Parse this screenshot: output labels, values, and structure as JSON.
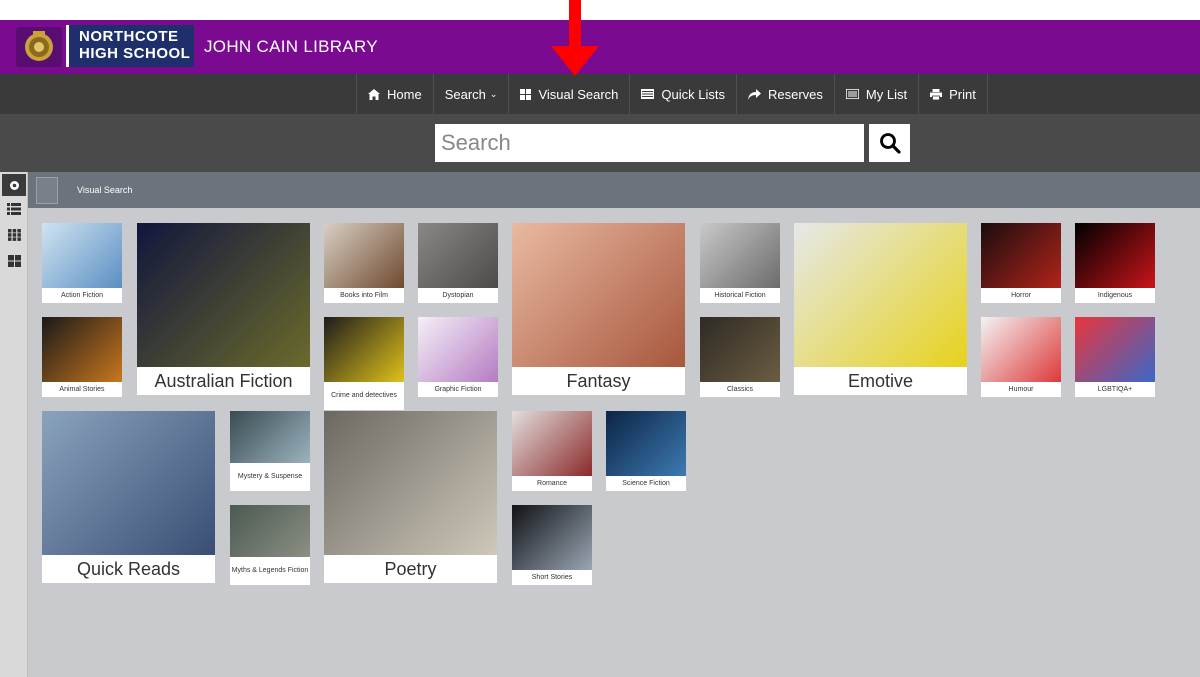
{
  "header": {
    "school_line1": "NORTHCOTE",
    "school_line2": "HIGH SCHOOL",
    "library_name": "JOHN CAIN LIBRARY"
  },
  "nav": {
    "items": [
      {
        "label": "Home",
        "icon": "home-icon"
      },
      {
        "label": "Search",
        "icon": "none",
        "dropdown": true
      },
      {
        "label": "Visual Search",
        "icon": "grid-icon"
      },
      {
        "label": "Quick Lists",
        "icon": "list-icon"
      },
      {
        "label": "Reserves",
        "icon": "share-icon"
      },
      {
        "label": "My List",
        "icon": "list-alt-icon"
      },
      {
        "label": "Print",
        "icon": "print-icon"
      }
    ]
  },
  "search": {
    "placeholder": "Search",
    "value": ""
  },
  "breadcrumb": {
    "current": "Visual Search"
  },
  "tiles": [
    {
      "label": "Action Fiction",
      "size": "small",
      "colors": [
        "#cfe3f2",
        "#5b8fc2"
      ]
    },
    {
      "label": "Animal Stories",
      "size": "small",
      "colors": [
        "#1a1a1a",
        "#c9771e"
      ]
    },
    {
      "label": "Australian Fiction",
      "size": "large",
      "colors": [
        "#11163d",
        "#6b6a2c"
      ]
    },
    {
      "label": "Books into Film",
      "size": "small",
      "colors": [
        "#d8cfc3",
        "#6f4a2e"
      ]
    },
    {
      "label": "Crime and detectives",
      "size": "small",
      "colors": [
        "#1c1c1c",
        "#e0c21a"
      ]
    },
    {
      "label": "Dystopian",
      "size": "small",
      "colors": [
        "#8a8884",
        "#4d4a47"
      ]
    },
    {
      "label": "Graphic Fiction",
      "size": "small",
      "colors": [
        "#f4f0f6",
        "#b57bc4"
      ]
    },
    {
      "label": "Fantasy",
      "size": "large",
      "colors": [
        "#e9b9a2",
        "#a7573c"
      ]
    },
    {
      "label": "Historical Fiction",
      "size": "small",
      "colors": [
        "#c9c9c9",
        "#6b6b6b"
      ]
    },
    {
      "label": "Classics",
      "size": "small",
      "colors": [
        "#2e2a24",
        "#6a5d42"
      ]
    },
    {
      "label": "Emotive",
      "size": "large",
      "colors": [
        "#e6e8ea",
        "#e7d21c"
      ]
    },
    {
      "label": "Horror",
      "size": "small",
      "colors": [
        "#1a0d0d",
        "#b2231b"
      ]
    },
    {
      "label": "Humour",
      "size": "small",
      "colors": [
        "#f3f3f3",
        "#dd3a3a"
      ]
    },
    {
      "label": "Indigenous",
      "size": "small",
      "colors": [
        "#000000",
        "#c8141b"
      ]
    },
    {
      "label": "LGBTIQA+",
      "size": "small",
      "colors": [
        "#e8353c",
        "#3a68c9"
      ]
    },
    {
      "label": "Quick Reads",
      "size": "large",
      "colors": [
        "#8aa3bd",
        "#3a4e74"
      ]
    },
    {
      "label": "Mystery & Suspense",
      "size": "small",
      "colors": [
        "#3a4b52",
        "#9bb3bf"
      ]
    },
    {
      "label": "Myths & Legends Fiction",
      "size": "small",
      "colors": [
        "#4a5a52",
        "#8c8f84"
      ]
    },
    {
      "label": "Poetry",
      "size": "large",
      "colors": [
        "#6b6860",
        "#cfc8bb"
      ]
    },
    {
      "label": "Romance",
      "size": "small",
      "colors": [
        "#e3dede",
        "#8a2a2a"
      ]
    },
    {
      "label": "Science Fiction",
      "size": "small",
      "colors": [
        "#0d2443",
        "#3c7ab4"
      ]
    },
    {
      "label": "Short Stories",
      "size": "small",
      "colors": [
        "#101216",
        "#9aa6b4"
      ]
    }
  ],
  "colors": {
    "banner": "#7a0a8f",
    "navbar": "#3a3a3a",
    "content_bg": "#c8cacd",
    "annotation_arrow": "#ff0000"
  }
}
